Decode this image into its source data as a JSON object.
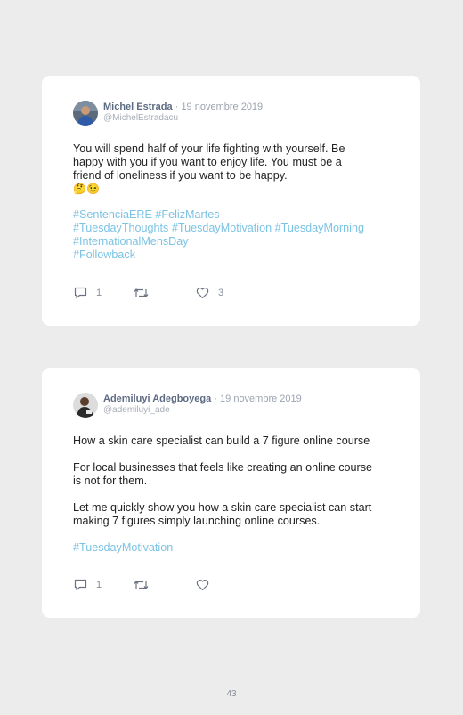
{
  "tweets": [
    {
      "author": "Michel Estrada",
      "separator": "·",
      "date": "19 novembre 2019",
      "handle": "@MichelEstradacu",
      "text_lines": [
        "You will spend half of your life fighting with yourself. Be",
        "happy with you if you want to enjoy life. You must be a",
        "friend of loneliness if you want to be happy."
      ],
      "emojis": "🤔😉",
      "hashtag_lines": [
        [
          "#SentenciaERE",
          "#FelizMartes"
        ],
        [
          "#TuesdayThoughts",
          "#TuesdayMotivation",
          "#TuesdayMorning"
        ],
        [
          "#InternationalMensDay"
        ],
        [
          "#Followback"
        ]
      ],
      "reply_count": "1",
      "retweet_count": "",
      "like_count": "3"
    },
    {
      "author": "Ademiluyi Adegboyega",
      "separator": "·",
      "date": "19 novembre 2019",
      "handle": "@ademiluyi_ade",
      "paragraphs": [
        [
          "How a skin care specialist can build a 7 figure online course"
        ],
        [
          "For local businesses that feels like creating an online course",
          "is not for them."
        ],
        [
          "Let me quickly show you how a skin care specialist can start",
          "making 7 figures simply launching online courses."
        ]
      ],
      "hashtags": [
        "#TuesdayMotivation"
      ],
      "reply_count": "1",
      "retweet_count": "",
      "like_count": ""
    }
  ],
  "page_number": "43",
  "colors": {
    "hashtag": "#7cc3e3",
    "author": "#5d6b82",
    "background": "#ececec"
  },
  "icons": [
    "reply-icon",
    "retweet-icon",
    "like-icon"
  ]
}
